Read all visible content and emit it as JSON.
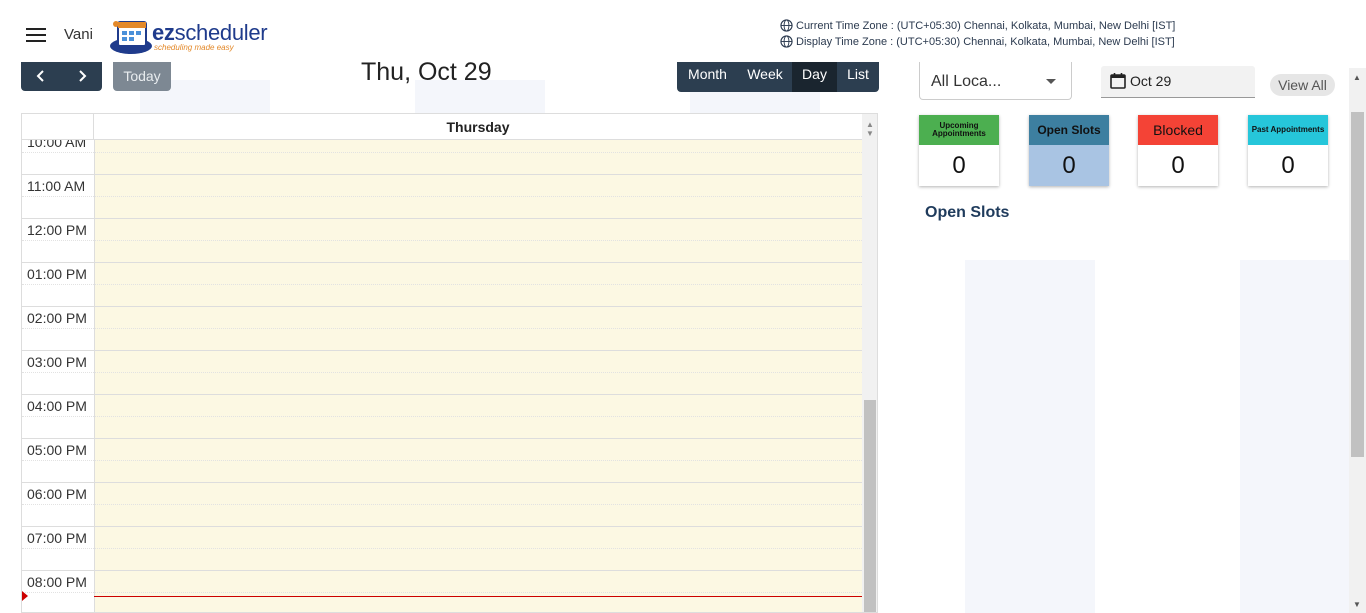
{
  "header": {
    "user_name": "Vani",
    "logo_text_bold": "ez",
    "logo_text": "scheduler",
    "logo_tagline": "scheduling made easy",
    "current_tz": "Current Time Zone : (UTC+05:30) Chennai, Kolkata, Mumbai, New Delhi [IST]",
    "display_tz": "Display Time Zone : (UTC+05:30) Chennai, Kolkata, Mumbai, New Delhi [IST]"
  },
  "toolbar": {
    "today_label": "Today",
    "title": "Thu, Oct 29",
    "views": [
      "Month",
      "Week",
      "Day",
      "List"
    ],
    "active_view": "Day"
  },
  "calendar": {
    "day_header": "Thursday",
    "time_labels": [
      "10:00 AM",
      "11:00 AM",
      "12:00 PM",
      "01:00 PM",
      "02:00 PM",
      "03:00 PM",
      "04:00 PM",
      "05:00 PM",
      "06:00 PM",
      "07:00 PM",
      "08:00 PM"
    ]
  },
  "sidebar": {
    "location_value": "All Loca...",
    "date_value": "Oct 29",
    "view_all_label": "View All",
    "stats": [
      {
        "label": "Upcoming Appointments",
        "value": "0",
        "color": "#4caf50"
      },
      {
        "label": "Open Slots",
        "value": "0",
        "color": "#3d7fa0"
      },
      {
        "label": "Blocked",
        "value": "0",
        "color": "#f44336"
      },
      {
        "label": "Past Appointments",
        "value": "0",
        "color": "#26c6da"
      }
    ],
    "section_title": "Open Slots"
  }
}
